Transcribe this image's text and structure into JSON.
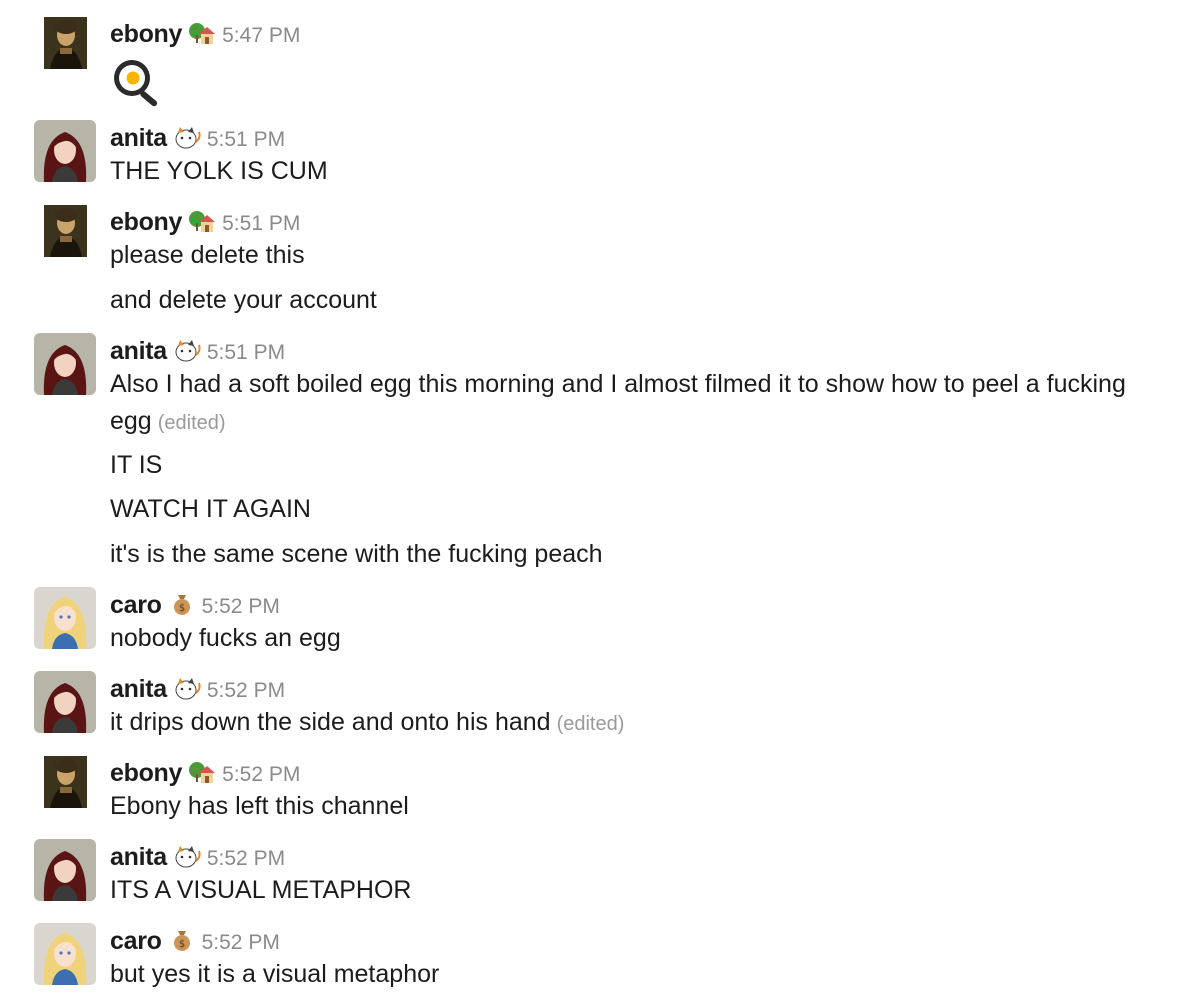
{
  "users": {
    "ebony": {
      "name": "ebony",
      "status_icon": "house-tree-emoji-icon",
      "avatar": "painting-portrait-avatar"
    },
    "anita": {
      "name": "anita",
      "status_icon": "calico-cat-emoji-icon",
      "avatar": "dark-haired-woman-avatar"
    },
    "caro": {
      "name": "caro",
      "status_icon": "money-bag-emoji-icon",
      "avatar": "blonde-woman-avatar"
    }
  },
  "messages": [
    {
      "user": "ebony",
      "time": "5:47 PM",
      "lines": [
        {
          "emoji": "fried-egg-pan-emoji"
        }
      ]
    },
    {
      "user": "anita",
      "time": "5:51 PM",
      "lines": [
        {
          "text": "THE YOLK IS CUM"
        }
      ]
    },
    {
      "user": "ebony",
      "time": "5:51 PM",
      "lines": [
        {
          "text": "please delete this"
        },
        {
          "text": "and delete your account"
        }
      ]
    },
    {
      "user": "anita",
      "time": "5:51 PM",
      "lines": [
        {
          "text": "Also I had a soft boiled egg this morning and I almost filmed it to show how to peel a fucking"
        },
        {
          "text": "egg",
          "edited": "(edited)"
        },
        {
          "text": "IT IS"
        },
        {
          "text": "WATCH IT AGAIN"
        },
        {
          "text": "it's is the same scene with the fucking peach"
        }
      ]
    },
    {
      "user": "caro",
      "time": "5:52 PM",
      "lines": [
        {
          "text": "nobody fucks an egg"
        }
      ]
    },
    {
      "user": "anita",
      "time": "5:52 PM",
      "lines": [
        {
          "text": "it drips down the side and onto his hand",
          "edited": "(edited)"
        }
      ]
    },
    {
      "user": "ebony",
      "time": "5:52 PM",
      "lines": [
        {
          "text": "Ebony has left this channel"
        }
      ]
    },
    {
      "user": "anita",
      "time": "5:52 PM",
      "lines": [
        {
          "text": "ITS A VISUAL METAPHOR"
        }
      ]
    },
    {
      "user": "caro",
      "time": "5:52 PM",
      "lines": [
        {
          "text": "but yes it is a visual metaphor"
        }
      ]
    }
  ]
}
